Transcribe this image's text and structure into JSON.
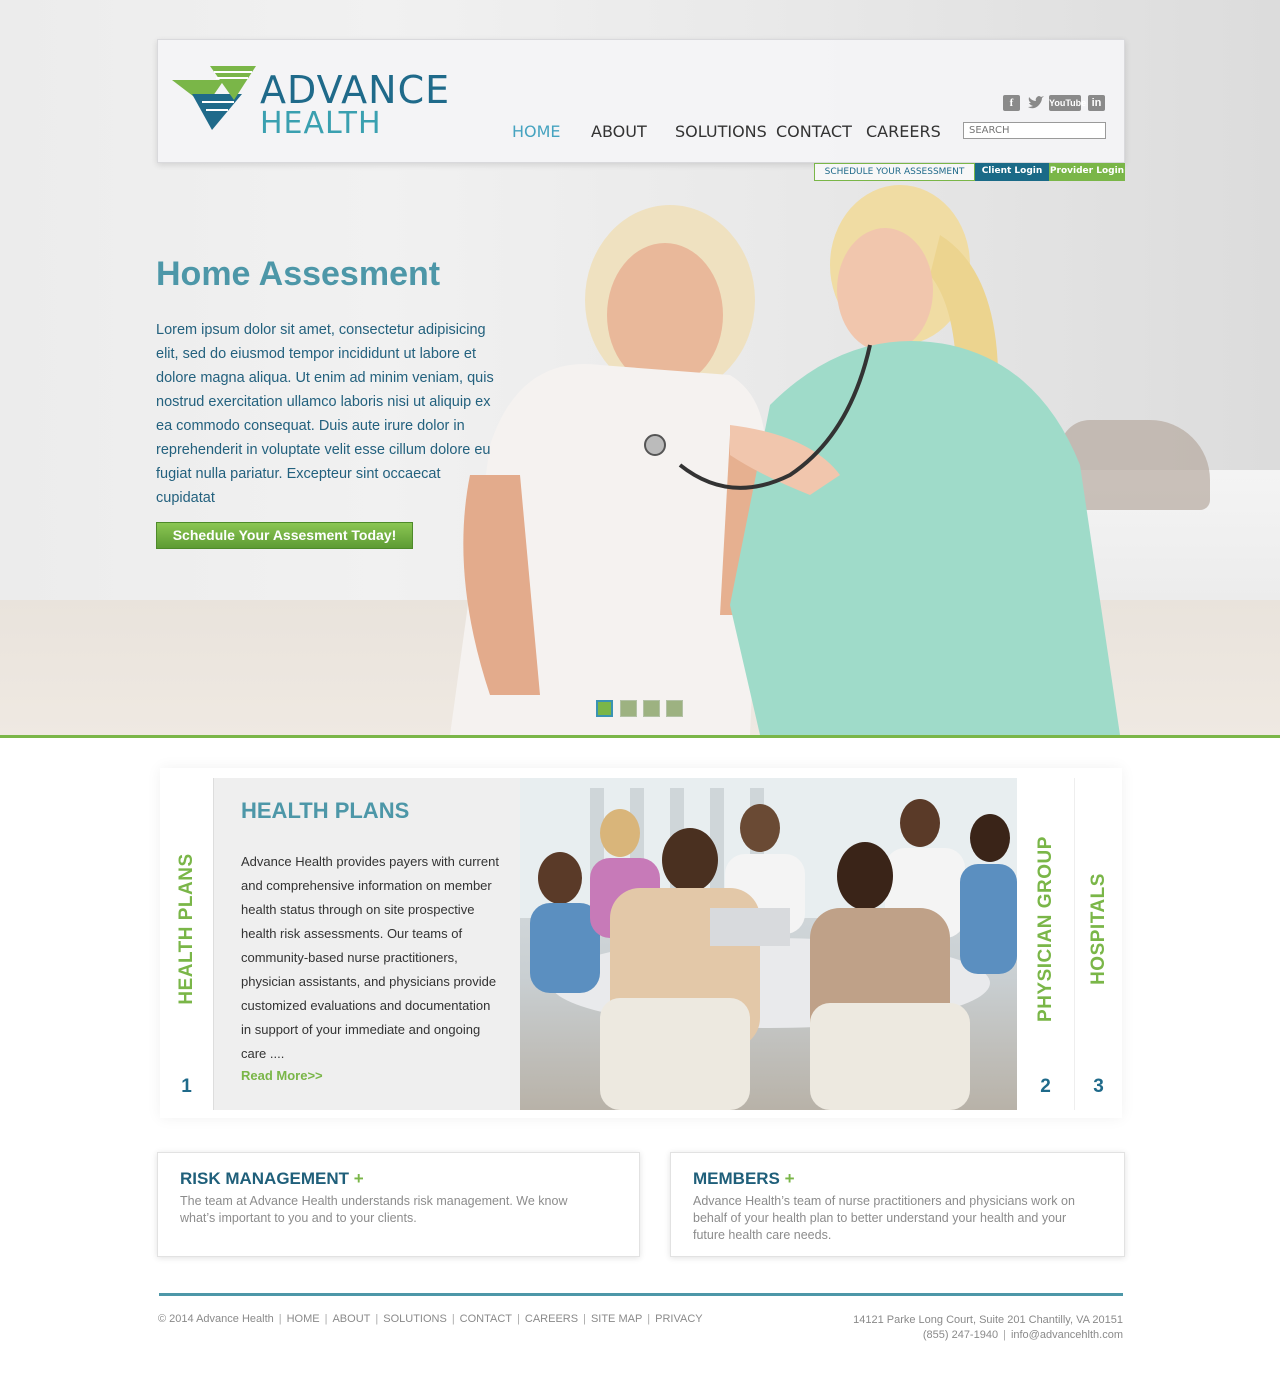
{
  "brand": {
    "line1": "ADVANCE",
    "line2": "HEALTH"
  },
  "nav": [
    {
      "label": "HOME",
      "active": true
    },
    {
      "label": "ABOUT",
      "active": false
    },
    {
      "label": "SOLUTIONS",
      "active": false
    },
    {
      "label": "CONTACT",
      "active": false
    },
    {
      "label": "CAREERS",
      "active": false
    }
  ],
  "social": {
    "facebook": "f",
    "twitter": "t",
    "youtube": "YouTube",
    "linkedin": "in"
  },
  "search": {
    "placeholder": "SEARCH"
  },
  "subnav": {
    "schedule": "SCHEDULE YOUR ASSESSMENT",
    "client": "Client Login",
    "provider": "Provider Login"
  },
  "hero": {
    "title": "Home Assesment",
    "body": "Lorem ipsum dolor sit amet, consectetur adipisicing elit, sed do eiusmod tempor incididunt ut labore et dolore magna aliqua. Ut enim ad minim veniam, quis nostrud exercitation ullamco laboris nisi ut aliquip ex ea commodo consequat. Duis aute irure dolor in reprehenderit in voluptate velit esse cillum dolore eu fugiat nulla pariatur. Excepteur sint occaecat cupidatat",
    "cta": "Schedule Your Assesment Today!",
    "slides": 4,
    "active_slide": 1
  },
  "tabs": [
    {
      "label": "HEALTH PLANS",
      "number": "1"
    },
    {
      "label": "PHYSICIAN GROUP",
      "number": "2"
    },
    {
      "label": "HOSPITALS",
      "number": "3"
    }
  ],
  "panel": {
    "title": "HEALTH PLANS",
    "body": "Advance Health provides payers with current and comprehensive information on member health status through on site prospective health risk assessments.  Our teams of community-based nurse practitioners, physician assistants, and physicians provide customized evaluations and documentation in support of your immediate and ongoing care ....",
    "more": "Read More>>"
  },
  "cards": [
    {
      "title": "RISK MANAGEMENT",
      "plus": "+",
      "body": "The team at Advance Health understands risk management. We know what’s important to you and to your clients."
    },
    {
      "title": "MEMBERS",
      "plus": "+",
      "body": "Advance Health’s team of nurse practitioners and physicians work on behalf of your health plan to better understand your health and your future health care needs."
    }
  ],
  "footer": {
    "copyright": "© 2014 Advance Health",
    "links": [
      "HOME",
      "ABOUT",
      "SOLUTIONS",
      "CONTACT",
      "CAREERS",
      "SITE MAP",
      "PRIVACY"
    ],
    "address": "14121 Parke Long Court, Suite 201 Chantilly, VA 20151",
    "phone": "(855) 247-1940",
    "email": "info@advancehlth.com"
  },
  "colors": {
    "accent_green": "#7ab648",
    "accent_blue": "#1f6a8a",
    "accent_teal": "#4d97a8"
  }
}
